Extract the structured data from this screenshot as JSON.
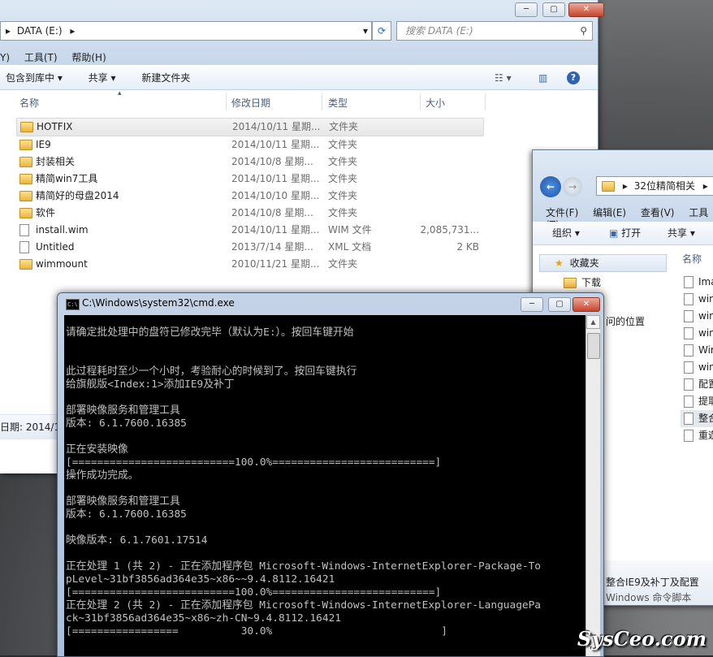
{
  "explorer_main": {
    "caption_buttons": [
      "─",
      "▢",
      "✕"
    ],
    "address": "DATA (E:)",
    "search_placeholder": "搜索 DATA (E:)",
    "menu": [
      "Y)",
      "工具(T)",
      "帮助(H)"
    ],
    "toolbar": {
      "include_library": "包含到库中 ▾",
      "share": "共享 ▾",
      "new_folder": "新建文件夹"
    },
    "columns": {
      "name": "名称",
      "date": "修改日期",
      "type": "类型",
      "size": "大小"
    },
    "files": [
      {
        "name": "HOTFIX",
        "date": "2014/10/11 星期...",
        "type": "文件夹",
        "size": "",
        "kind": "folder"
      },
      {
        "name": "IE9",
        "date": "2014/10/11 星期...",
        "type": "文件夹",
        "size": "",
        "kind": "folder"
      },
      {
        "name": "封装相关",
        "date": "2014/10/8 星期...",
        "type": "文件夹",
        "size": "",
        "kind": "folder"
      },
      {
        "name": "精简win7工具",
        "date": "2014/10/11 星期...",
        "type": "文件夹",
        "size": "",
        "kind": "folder"
      },
      {
        "name": "精简好的母盘2014",
        "date": "2014/10/10 星期...",
        "type": "文件夹",
        "size": "",
        "kind": "folder"
      },
      {
        "name": "软件",
        "date": "2014/10/8 星期...",
        "type": "文件夹",
        "size": "",
        "kind": "folder"
      },
      {
        "name": "install.wim",
        "date": "2014/10/11 星期...",
        "type": "WIM 文件",
        "size": "2,085,731...",
        "kind": "file"
      },
      {
        "name": "Untitled",
        "date": "2013/7/14 星期...",
        "type": "XML 文档",
        "size": "2 KB",
        "kind": "file"
      },
      {
        "name": "wimmount",
        "date": "2010/11/21 星期...",
        "type": "文件夹",
        "size": "",
        "kind": "folder"
      }
    ],
    "status_text": "日期: 2014/1"
  },
  "explorer_second": {
    "address": "32位精简相关",
    "menu": [
      "文件(F)",
      "编辑(E)",
      "查看(V)",
      "工具(T)"
    ],
    "toolbar": {
      "organize": "组织 ▾",
      "open": "打开",
      "share": "共享 ▾"
    },
    "column_name": "名称",
    "nav": {
      "favorites": "收藏夹",
      "downloads": "下载",
      "recent": "问的位置"
    },
    "files": [
      "Ima",
      "win",
      "win",
      "win",
      "Wir",
      "win",
      "配置",
      "提耶",
      "整合",
      "重遊"
    ],
    "detail_name": "整合IE9及补丁及配置",
    "detail_type": "Windows 命令脚本"
  },
  "cmd": {
    "title": "C:\\Windows\\system32\\cmd.exe",
    "lines": [
      "请确定批处理中的盘符已修改完毕（默认为E:）。按回车键开始",
      "",
      "",
      "此过程耗时至少一个小时，考验耐心的时候到了。按回车键执行",
      "给旗舰版<Index:1>添加IE9及补丁",
      "",
      "部署映像服务和管理工具",
      "版本: 6.1.7600.16385",
      "",
      "正在安装映像",
      "[==========================100.0%==========================]",
      "操作成功完成。",
      "",
      "部署映像服务和管理工具",
      "版本: 6.1.7600.16385",
      "",
      "映像版本: 6.1.7601.17514",
      "",
      "正在处理 1 (共 2) - 正在添加程序包 Microsoft-Windows-InternetExplorer-Package-To",
      "pLevel~31bf3856ad364e35~x86~~9.4.8112.16421",
      "[==========================100.0%==========================]",
      "正在处理 2 (共 2) - 正在添加程序包 Microsoft-Windows-InternetExplorer-LanguagePa",
      "ck~31bf3856ad364e35~x86~zh-CN~9.4.8112.16421",
      "[=================          30.0%                           ]"
    ]
  },
  "watermark": "SysCeo.com"
}
